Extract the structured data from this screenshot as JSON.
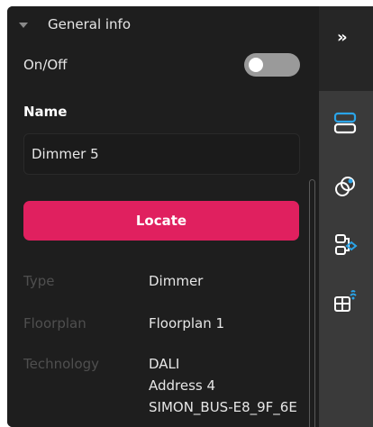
{
  "section": {
    "title": "General info"
  },
  "onoff": {
    "label": "On/Off",
    "state": "off"
  },
  "name": {
    "label": "Name",
    "value": "Dimmer 5"
  },
  "locate": {
    "label": "Locate"
  },
  "properties": [
    {
      "key": "Type",
      "value": "Dimmer"
    },
    {
      "key": "Floorplan",
      "value": "Floorplan 1"
    },
    {
      "key": "Technology",
      "value": "DALI",
      "extra": [
        "Address 4",
        "SIMON_BUS-E8_9F_6E"
      ]
    }
  ],
  "rail": {
    "collapse_symbol": "»",
    "icons": [
      "devices-icon",
      "link-icon",
      "flow-icon",
      "floorplan-wireless-icon"
    ],
    "active_color": "#2aa4e8"
  }
}
